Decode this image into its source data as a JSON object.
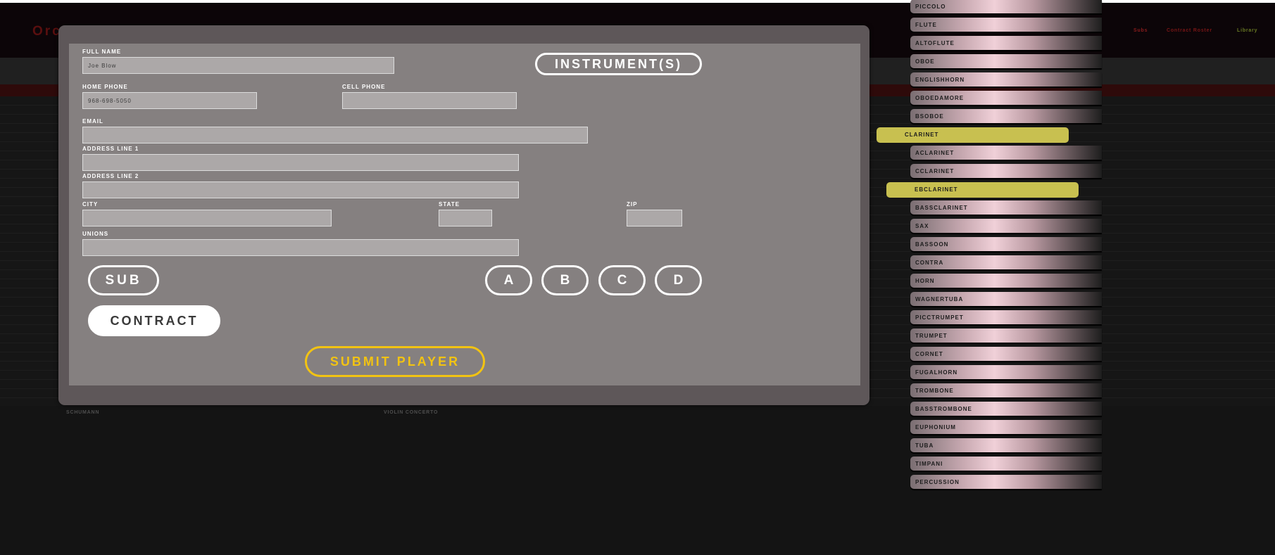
{
  "header": {
    "brand": "Orc",
    "nav": [
      "Subs",
      "Contract Roster",
      "Library"
    ],
    "nav_colors": {
      "subs": "#8b1c1c",
      "contract_roster": "#7a1616",
      "library": "#6a7a24"
    }
  },
  "background_table": {
    "composer": "SCHUMANN",
    "work": "VIOLIN CONCERTO"
  },
  "form": {
    "full_name": {
      "label": "FULL NAME",
      "value": "Joe Blow"
    },
    "home_phone": {
      "label": "HOME PHONE",
      "value": "968-698-5050"
    },
    "cell_phone": {
      "label": "CELL PHONE",
      "value": ""
    },
    "email": {
      "label": "EMAIL",
      "value": ""
    },
    "address1": {
      "label": "ADDRESS LINE 1",
      "value": ""
    },
    "address2": {
      "label": "ADDRESS LINE 2",
      "value": ""
    },
    "city": {
      "label": "CITY",
      "value": ""
    },
    "state": {
      "label": "STATE",
      "value": ""
    },
    "zip": {
      "label": "ZIP",
      "value": ""
    },
    "unions": {
      "label": "UNIONS",
      "value": ""
    }
  },
  "buttons": {
    "instruments": "INSTRUMENT(S)",
    "sub": "SUB",
    "contract": "CONTRACT",
    "submit": "SUBMIT PLAYER",
    "grades": [
      "A",
      "B",
      "C",
      "D"
    ]
  },
  "instruments": [
    {
      "label": "PICCOLO",
      "selected": false
    },
    {
      "label": "FLUTE",
      "selected": false
    },
    {
      "label": "ALTOFLUTE",
      "selected": false
    },
    {
      "label": "OBOE",
      "selected": false
    },
    {
      "label": "ENGLISHHORN",
      "selected": false
    },
    {
      "label": "OBOEDAMORE",
      "selected": false
    },
    {
      "label": "BSOBOE",
      "selected": false
    },
    {
      "label": "CLARINET",
      "selected": true
    },
    {
      "label": "ACLARINET",
      "selected": false
    },
    {
      "label": "CCLARINET",
      "selected": false
    },
    {
      "label": "EBCLARINET",
      "selected": true
    },
    {
      "label": "BASSCLARINET",
      "selected": false
    },
    {
      "label": "SAX",
      "selected": false
    },
    {
      "label": "BASSOON",
      "selected": false
    },
    {
      "label": "CONTRA",
      "selected": false
    },
    {
      "label": "HORN",
      "selected": false
    },
    {
      "label": "WAGNERTUBA",
      "selected": false
    },
    {
      "label": "PICCTRUMPET",
      "selected": false
    },
    {
      "label": "TRUMPET",
      "selected": false
    },
    {
      "label": "CORNET",
      "selected": false
    },
    {
      "label": "FUGALHORN",
      "selected": false
    },
    {
      "label": "TROMBONE",
      "selected": false
    },
    {
      "label": "BASSTROMBONE",
      "selected": false
    },
    {
      "label": "EUPHONIUM",
      "selected": false
    },
    {
      "label": "TUBA",
      "selected": false
    },
    {
      "label": "TIMPANI",
      "selected": false
    },
    {
      "label": "PERCUSSION",
      "selected": false
    }
  ],
  "colors": {
    "accent_yellow": "#f2c312",
    "selected_item": "#c8c050",
    "panel": "#858080"
  }
}
